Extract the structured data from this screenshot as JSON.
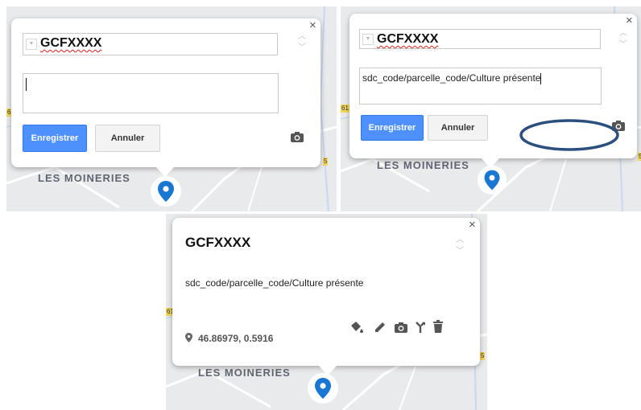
{
  "popups": [
    {
      "title": "GCFXXXX",
      "description": "",
      "save_label": "Enregistrer",
      "cancel_label": "Annuler",
      "close_glyph": "×"
    },
    {
      "title": "GCFXXXX",
      "description": "sdc_code/parcelle_code/Culture présente",
      "save_label": "Enregistrer",
      "cancel_label": "Annuler",
      "close_glyph": "×",
      "annotation_ellipse_color": "#2b4f7e"
    },
    {
      "title": "GCFXXXX",
      "description": "sdc_code/parcelle_code/Culture présente",
      "coordinates": "46.86979, 0.5916",
      "close_glyph": "×",
      "icons": [
        "paint-bucket-icon",
        "pencil-icon",
        "camera-icon",
        "route-icon",
        "trash-icon"
      ]
    }
  ],
  "map": {
    "place_label": "LES MOINERIES",
    "road_label_left": "61",
    "road_label_right": "5",
    "pin_color": "#1976d2",
    "accent": "#4d90fe"
  }
}
